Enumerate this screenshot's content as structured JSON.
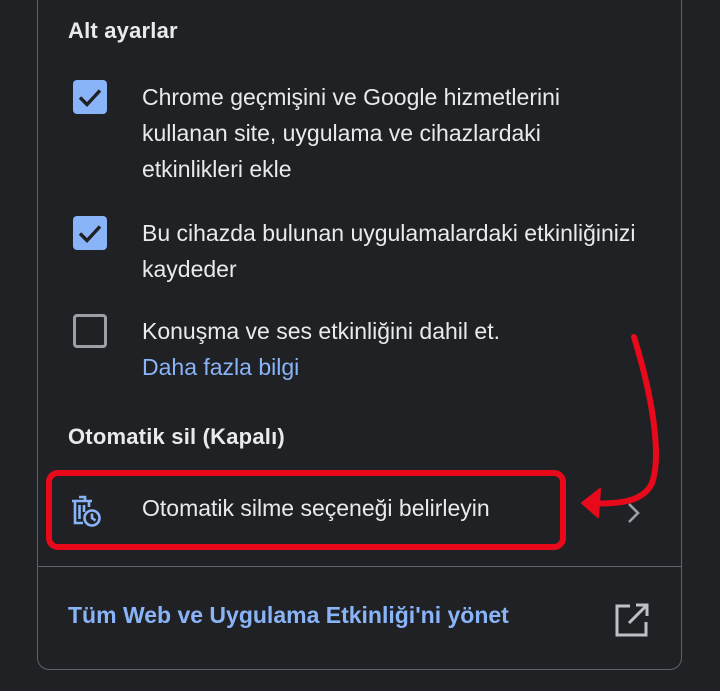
{
  "sub_settings": {
    "title": "Alt ayarlar",
    "items": [
      {
        "label": "Chrome geçmişini ve Google hizmetlerini kullanan site, uygulama ve cihazlardaki etkinlikleri ekle",
        "checked": true
      },
      {
        "label": "Bu cihazda bulunan uygulamalardaki etkinliğinizi kaydeder",
        "checked": true
      },
      {
        "label": "Konuşma ve ses etkinliğini dahil et.",
        "checked": false,
        "link": "Daha fazla bilgi"
      }
    ]
  },
  "auto_delete": {
    "title": "Otomatik sil (Kapalı)",
    "option_label": "Otomatik silme seçeneği belirleyin",
    "icon": "delete-history-icon"
  },
  "manage": {
    "label": "Tüm Web ve Uygulama Etkinliği'ni yönet",
    "icon": "open-in-new-icon"
  },
  "colors": {
    "background": "#202124",
    "accent": "#8ab4f8",
    "text": "#e8eaed",
    "annotation": "#e8091a"
  }
}
